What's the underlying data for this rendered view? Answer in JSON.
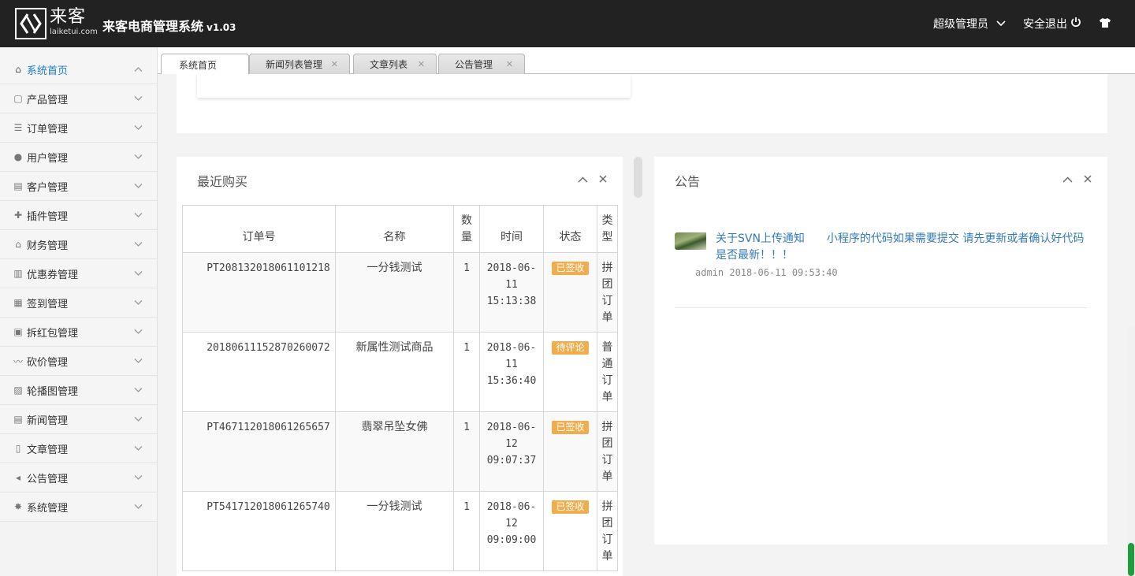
{
  "header": {
    "logo_cn": "来客",
    "logo_en": "laiketui.com",
    "system_title": "来客电商管理系统",
    "version": "v1.03",
    "admin_label": "超级管理员",
    "logout_label": "安全退出"
  },
  "sidebar": {
    "items": [
      {
        "label": "系统首页",
        "icon": "home-icon"
      },
      {
        "label": "产品管理",
        "icon": "bag-icon"
      },
      {
        "label": "订单管理",
        "icon": "list-icon"
      },
      {
        "label": "用户管理",
        "icon": "user-icon"
      },
      {
        "label": "客户管理",
        "icon": "contact-icon"
      },
      {
        "label": "插件管理",
        "icon": "puzzle-icon"
      },
      {
        "label": "财务管理",
        "icon": "bank-icon"
      },
      {
        "label": "优惠券管理",
        "icon": "coupon-icon"
      },
      {
        "label": "签到管理",
        "icon": "calendar-icon"
      },
      {
        "label": "拆红包管理",
        "icon": "redpacket-icon"
      },
      {
        "label": "砍价管理",
        "icon": "trend-icon"
      },
      {
        "label": "轮播图管理",
        "icon": "image-icon"
      },
      {
        "label": "新闻管理",
        "icon": "news-icon"
      },
      {
        "label": "文章管理",
        "icon": "file-icon"
      },
      {
        "label": "公告管理",
        "icon": "speaker-icon"
      },
      {
        "label": "系统管理",
        "icon": "gear-icon"
      }
    ]
  },
  "tabs": [
    {
      "label": "系统首页"
    },
    {
      "label": "新闻列表管理"
    },
    {
      "label": "文章列表"
    },
    {
      "label": "公告管理"
    }
  ],
  "purchase": {
    "title": "最近购买",
    "columns": [
      "订单号",
      "名称",
      "数量",
      "时间",
      "状态",
      "类型"
    ],
    "rows": [
      {
        "order_no": "PT208132018061101218",
        "name": "一分钱测试",
        "qty": "1",
        "date": "2018-06-",
        "day": "11",
        "clock": "15:13:38",
        "status": "已签收",
        "type": "拼团订单"
      },
      {
        "order_no": "20180611152870260072",
        "name": "新属性测试商品",
        "qty": "1",
        "date": "2018-06-",
        "day": "11",
        "clock": "15:36:40",
        "status": "待评论",
        "type": "普通订单"
      },
      {
        "order_no": "PT467112018061265657",
        "name": "翡翠吊坠女佛",
        "qty": "1",
        "date": "2018-06-",
        "day": "12",
        "clock": "09:07:37",
        "status": "已签收",
        "type": "拼团订单"
      },
      {
        "order_no": "PT541712018061265740",
        "name": "一分钱测试",
        "qty": "1",
        "date": "2018-06-",
        "day": "12",
        "clock": "09:09:00",
        "status": "已签收",
        "type": "拼团订单"
      }
    ]
  },
  "notice": {
    "title": "公告",
    "items": [
      {
        "text": "关于SVN上传通知　　小程序的代码如果需要提交 请先更新或者确认好代码是否最新！！！",
        "meta": "admin 2018-06-11 09:53:40"
      }
    ]
  },
  "colors": {
    "topbar": "#222222",
    "accent": "#1c7ad8",
    "badge": "#f0ad4e",
    "link": "#337ab7"
  }
}
